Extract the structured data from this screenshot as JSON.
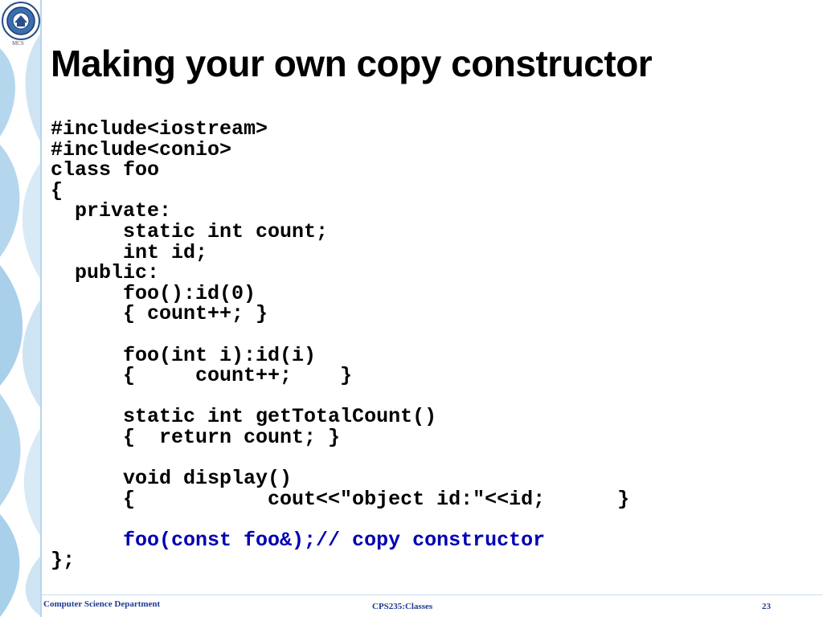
{
  "logo": {
    "caption": "MCS"
  },
  "slide": {
    "title": "Making your own copy constructor"
  },
  "code": {
    "lines": [
      "#include<iostream>",
      "#include<conio>",
      "class foo",
      "{",
      "  private:",
      "      static int count;",
      "      int id;",
      "  public:",
      "      foo():id(0)",
      "      { count++; }",
      "",
      "      foo(int i):id(i)",
      "      {     count++;    }",
      "",
      "      static int getTotalCount()",
      "      {  return count; }",
      "",
      "      void display()",
      "      {           cout<<\"object id:\"<<id;      }",
      "",
      "      foo(const foo&);// copy constructor",
      "};"
    ]
  },
  "footer": {
    "left": "Computer Science Department",
    "center": "CPS235:Classes",
    "page": "23"
  },
  "colors": {
    "highlight": "#0000b4",
    "strip": "#b5d7ee",
    "footer_text": "#1f3a93"
  }
}
